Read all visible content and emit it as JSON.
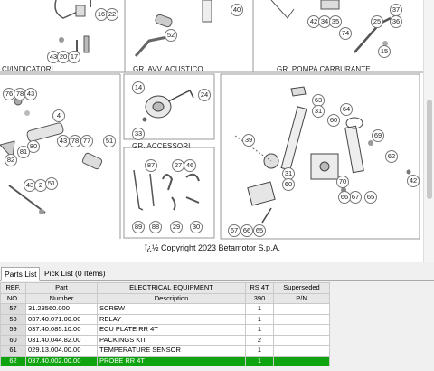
{
  "diagram": {
    "sections": [
      {
        "id": "indicatori",
        "title": "CI/INDICATORI"
      },
      {
        "id": "avv",
        "title": "GR. AVV. ACUSTICO"
      },
      {
        "id": "pompa",
        "title": "GR. POMPA CARBURANTE"
      },
      {
        "id": "accessori",
        "title": "GR. ACCESSORI"
      }
    ],
    "callouts": [
      "16",
      "22",
      "40",
      "52",
      "43",
      "20",
      "17",
      "74",
      "42",
      "34",
      "35",
      "25",
      "37",
      "36",
      "15",
      "76",
      "78",
      "43",
      "4",
      "80",
      "81",
      "82",
      "43",
      "78",
      "77",
      "51",
      "43",
      "2",
      "51",
      "14",
      "24",
      "33",
      "87",
      "27",
      "46",
      "89",
      "88",
      "29",
      "30",
      "63",
      "31",
      "64",
      "60",
      "39",
      "69",
      "62",
      "31",
      "60",
      "42",
      "70",
      "67",
      "65",
      "66",
      "67",
      "66",
      "65"
    ],
    "copyright": "ï¿½ Copyright 2023 Betamotor S.p.A."
  },
  "tabs": [
    {
      "label": "Parts List",
      "active": true
    },
    {
      "label": "Pick List (0 Items)",
      "active": false
    }
  ],
  "table": {
    "headers_row1": [
      "REF.",
      "Part",
      "ELECTRICAL EQUIPMENT",
      "RS 4T",
      "Superseded"
    ],
    "headers_row2": [
      "NO.",
      "Number",
      "Description",
      "390",
      "P/N"
    ],
    "rows": [
      {
        "ref": "57",
        "part": "31.23560.000",
        "desc": "SCREW",
        "qty": "1",
        "sup": "",
        "selected": false
      },
      {
        "ref": "58",
        "part": "037.40.071.00.00",
        "desc": "RELAY",
        "qty": "1",
        "sup": "",
        "selected": false
      },
      {
        "ref": "59",
        "part": "037.40.085.10.00",
        "desc": "ECU PLATE RR 4T",
        "qty": "1",
        "sup": "",
        "selected": false
      },
      {
        "ref": "60",
        "part": "031.40.044.82.00",
        "desc": "PACKINGS KIT",
        "qty": "2",
        "sup": "",
        "selected": false
      },
      {
        "ref": "61",
        "part": "029.13.004.00.00",
        "desc": "TEMPERATURE SENSOR",
        "qty": "1",
        "sup": "",
        "selected": false
      },
      {
        "ref": "62",
        "part": "037.40.002.00.00",
        "desc": "PROBE RR 4T",
        "qty": "1",
        "sup": "",
        "selected": true
      }
    ]
  }
}
